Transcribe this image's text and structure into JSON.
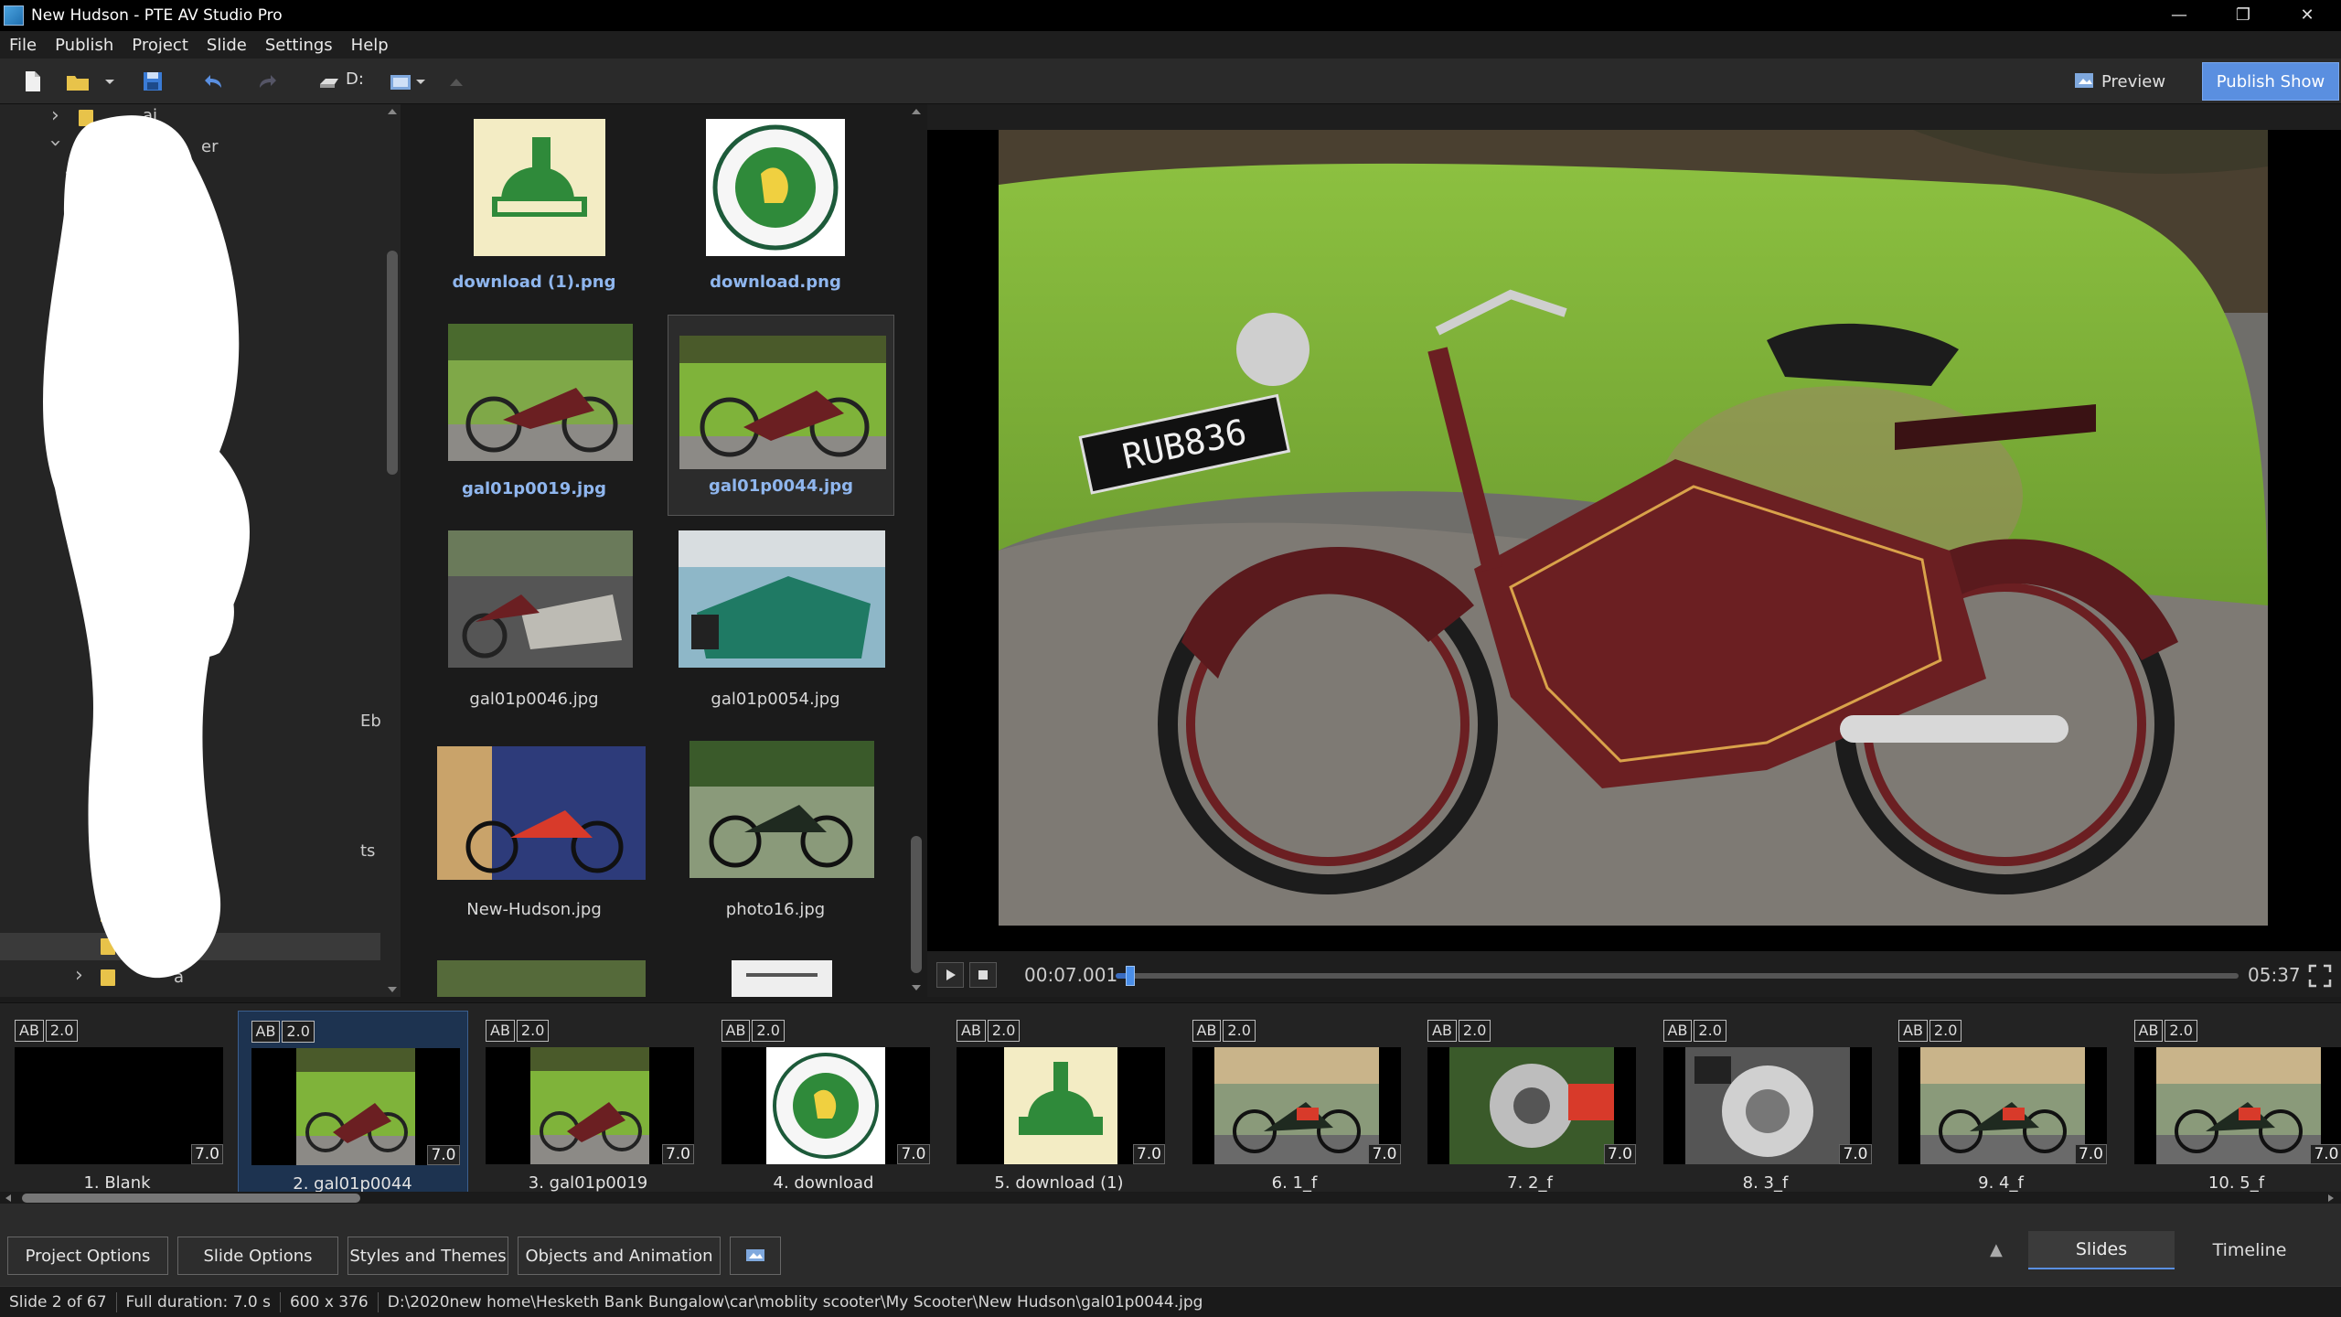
{
  "window": {
    "title": "New Hudson - PTE AV Studio Pro",
    "minimize": "—",
    "restore": "❐",
    "close": "✕"
  },
  "menu": [
    "File",
    "Publish",
    "Project",
    "Slide",
    "Settings",
    "Help"
  ],
  "toolbar": {
    "drive": "D:",
    "preview_label": "Preview",
    "publish_label": "Publish Show"
  },
  "tree": {
    "fragments": [
      "ai",
      "er",
      "Eb",
      "ts",
      "a"
    ]
  },
  "files": [
    {
      "name": "download (1).png",
      "highlight": true
    },
    {
      "name": "download.png",
      "highlight": true
    },
    {
      "name": "gal01p0019.jpg",
      "highlight": true
    },
    {
      "name": "gal01p0044.jpg",
      "highlight": true,
      "selected": true
    },
    {
      "name": "gal01p0046.jpg",
      "highlight": false
    },
    {
      "name": "gal01p0054.jpg",
      "highlight": false
    },
    {
      "name": "New-Hudson.jpg",
      "highlight": false
    },
    {
      "name": "photo16.jpg",
      "highlight": false
    }
  ],
  "preview_image": {
    "plate_text": "RUB836"
  },
  "playback": {
    "current": "00:07.001",
    "total": "05:37",
    "progress_fraction": 0.013
  },
  "slides": [
    {
      "ab": "AB",
      "trans": "2.0",
      "dur": "7.0",
      "label": "1. Blank",
      "kind": "blank"
    },
    {
      "ab": "AB",
      "trans": "2.0",
      "dur": "7.0",
      "label": "2. gal01p0044",
      "kind": "bike",
      "selected": true
    },
    {
      "ab": "AB",
      "trans": "2.0",
      "dur": "7.0",
      "label": "3. gal01p0019",
      "kind": "bike"
    },
    {
      "ab": "AB",
      "trans": "2.0",
      "dur": "7.0",
      "label": "4. download",
      "kind": "badge"
    },
    {
      "ab": "AB",
      "trans": "2.0",
      "dur": "7.0",
      "label": "5. download (1)",
      "kind": "logo"
    },
    {
      "ab": "AB",
      "trans": "2.0",
      "dur": "7.0",
      "label": "6. 1_f",
      "kind": "dark"
    },
    {
      "ab": "AB",
      "trans": "2.0",
      "dur": "7.0",
      "label": "7. 2_f",
      "kind": "engine"
    },
    {
      "ab": "AB",
      "trans": "2.0",
      "dur": "7.0",
      "label": "8. 3_f",
      "kind": "engine2"
    },
    {
      "ab": "AB",
      "trans": "2.0",
      "dur": "7.0",
      "label": "9. 4_f",
      "kind": "dark"
    },
    {
      "ab": "AB",
      "trans": "2.0",
      "dur": "7.0",
      "label": "10. 5_f",
      "kind": "dark"
    }
  ],
  "bottom": {
    "project_options": "Project Options",
    "slide_options": "Slide Options",
    "styles_themes": "Styles and Themes",
    "objects_animation": "Objects and Animation",
    "tab_slides": "Slides",
    "tab_timeline": "Timeline"
  },
  "status": {
    "slide": "Slide 2 of 67",
    "duration": "Full duration: 7.0 s",
    "size": "600 x 376",
    "path": "D:\\2020new home\\Hesketh Bank Bungalow\\car\\moblity scooter\\My Scooter\\New Hudson\\gal01p0044.jpg"
  },
  "colors": {
    "accent": "#5a8fe0",
    "bike_red": "#6b1f22",
    "grass": "#7fb33a",
    "logo_green": "#2f8a3a"
  }
}
